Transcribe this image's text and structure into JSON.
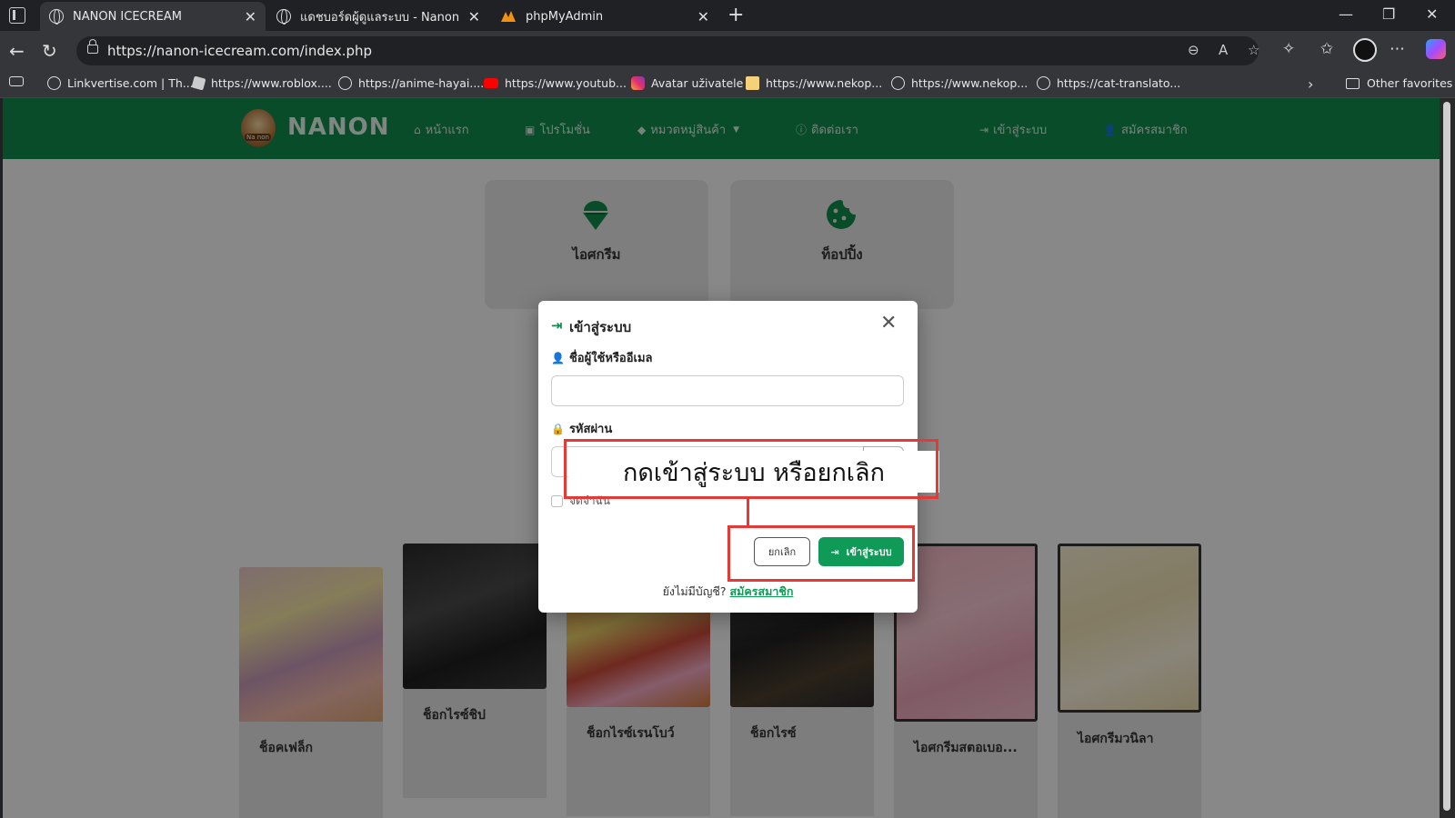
{
  "browser": {
    "tabs": [
      {
        "title": "NANON ICECREAM",
        "active": true
      },
      {
        "title": "แดชบอร์ดผู้ดูแลระบบ - Nanon Admin",
        "active": false
      },
      {
        "title": "phpMyAdmin",
        "active": false
      }
    ],
    "url": "https://nanon-icecream.com/index.php",
    "bookmarks": [
      {
        "label": "Linkvertise.com | Th...",
        "icon": "globe-icon"
      },
      {
        "label": "https://www.roblox....",
        "icon": "roblox-icon"
      },
      {
        "label": "https://anime-hayai....",
        "icon": "globe-icon"
      },
      {
        "label": "https://www.youtub...",
        "icon": "youtube-icon"
      },
      {
        "label": "Avatar uživatele",
        "icon": "instagram-icon"
      },
      {
        "label": "https://www.nekop...",
        "icon": "cat-icon"
      },
      {
        "label": "https://www.nekop...",
        "icon": "globe-icon"
      },
      {
        "label": "https://cat-translato...",
        "icon": "globe-icon"
      }
    ],
    "other_favorites": "Other favorites"
  },
  "site": {
    "brand": "NANON",
    "logo_text": "Na non",
    "nav": {
      "home": "หน้าแรก",
      "promo": "โปรโมชั่น",
      "categories": "หมวดหมู่สินค้า",
      "contact": "ติดต่อเรา",
      "login": "เข้าสู่ระบบ",
      "register": "สมัครสมาชิก"
    },
    "category_cards": [
      {
        "label": "ไอศกรีม",
        "icon": "ice-cream-icon"
      },
      {
        "label": "ท็อปปิ้ง",
        "icon": "cookie-icon"
      }
    ],
    "products": [
      {
        "name": "ช็อคเฟล็ก"
      },
      {
        "name": "ช็อกไรซ์ชิป"
      },
      {
        "name": "ช็อกไรซ์เรนโบว์"
      },
      {
        "name": "ช็อกไรซ์"
      },
      {
        "name": "ไอศกรีมสตอเบอ..."
      },
      {
        "name": "ไอศกรีมวนิลา"
      }
    ]
  },
  "modal": {
    "title": "เข้าสู่ระบบ",
    "username_label": "ชื่อผู้ใช้หรืออีเมล",
    "username_value": "",
    "password_label": "รหัสผ่าน",
    "password_value": "",
    "remember_label": "จดจำฉัน",
    "cancel_label": "ยกเลิก",
    "login_label": "เข้าสู่ระบบ",
    "no_account_text": "ยังไม่มีบัญชี?",
    "register_link": "สมัครสมาชิก"
  },
  "annotation": {
    "text": "กดเข้าสู่ระบบ หรือยกเลิก",
    "color": "#e53935"
  },
  "colors": {
    "brand_green": "#0f8a4e",
    "button_green": "#0f9a57"
  }
}
